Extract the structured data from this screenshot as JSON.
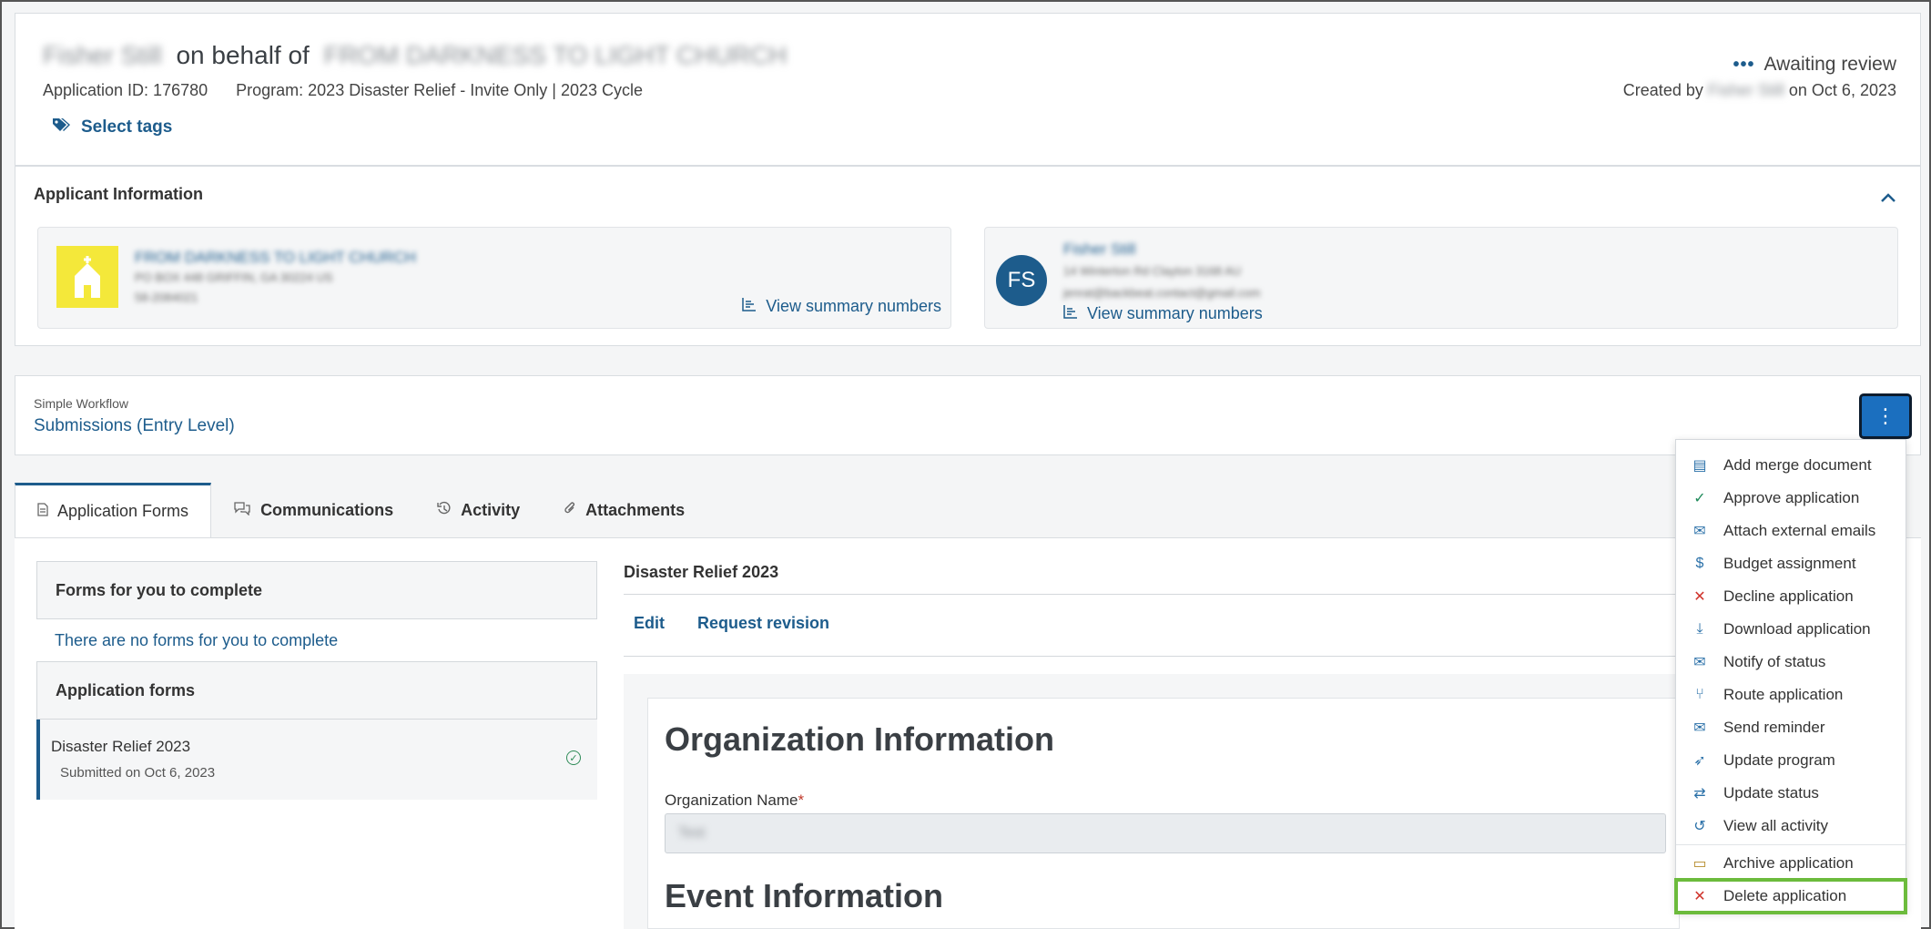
{
  "header": {
    "applicant_name_blurred": "Fisher Still",
    "on_behalf_of": "on behalf of",
    "organization_blurred": "FROM DARKNESS TO LIGHT CHURCH",
    "application_id": "Application ID: 176780",
    "program": "Program: 2023 Disaster Relief - Invite Only | 2023 Cycle",
    "select_tags_label": "Select tags",
    "status_label": "Awaiting review",
    "created_prefix": "Created by",
    "created_by_blurred": "Fisher Still",
    "created_suffix": "on Oct 6, 2023"
  },
  "applicant_info": {
    "title": "Applicant Information",
    "organization": {
      "name": "FROM DARKNESS TO LIGHT CHURCH",
      "address": "PO BOX 448 GRIFFIN, GA 30224 US",
      "ein": "58-2084021",
      "summary_link": "View summary numbers"
    },
    "person": {
      "initials": "FS",
      "name": "Fisher Still",
      "address": "14 Winterton Rd Clayton 3168 AU",
      "email": "jenrat@backbeat.contact@gmail.com",
      "summary_link": "View summary numbers"
    }
  },
  "workflow": {
    "label": "Simple Workflow",
    "value": "Submissions (Entry Level)",
    "kebab": "⋮"
  },
  "tabs": [
    {
      "label": "Application Forms",
      "icon": "document-icon"
    },
    {
      "label": "Communications",
      "icon": "chat-icon"
    },
    {
      "label": "Activity",
      "icon": "history-icon"
    },
    {
      "label": "Attachments",
      "icon": "paperclip-icon"
    }
  ],
  "forms_panel": {
    "to_complete_title": "Forms for you to complete",
    "empty_message": "There are no forms for you to complete",
    "application_forms_title": "Application forms",
    "form_name": "Disaster Relief 2023",
    "form_sub": "Submitted on Oct 6, 2023"
  },
  "form_preview": {
    "title": "Disaster Relief 2023",
    "edit_label": "Edit",
    "request_revision_label": "Request revision",
    "heading_org": "Organization Information",
    "org_name_label": "Organization Name",
    "required_mark": "*",
    "org_name_value": "Test",
    "heading_event": "Event Information"
  },
  "menu": {
    "items": [
      {
        "label": "Add merge document",
        "icon": "merge-document-icon",
        "glyph": "▤"
      },
      {
        "label": "Approve application",
        "icon": "check-icon",
        "glyph": "✓"
      },
      {
        "label": "Attach external emails",
        "icon": "email-attach-icon",
        "glyph": "✉"
      },
      {
        "label": "Budget assignment",
        "icon": "dollar-icon",
        "glyph": "$"
      },
      {
        "label": "Decline application",
        "icon": "x-icon",
        "glyph": "✕"
      },
      {
        "label": "Download application",
        "icon": "download-icon",
        "glyph": "⤓"
      },
      {
        "label": "Notify of status",
        "icon": "envelope-icon",
        "glyph": "✉"
      },
      {
        "label": "Route application",
        "icon": "route-icon",
        "glyph": "⑂"
      },
      {
        "label": "Send reminder",
        "icon": "envelope-icon",
        "glyph": "✉"
      },
      {
        "label": "Update program",
        "icon": "rocket-icon",
        "glyph": "➶"
      },
      {
        "label": "Update status",
        "icon": "swap-icon",
        "glyph": "⇄"
      },
      {
        "label": "View all activity",
        "icon": "history-icon",
        "glyph": "↺"
      },
      {
        "label": "Archive application",
        "icon": "archive-icon",
        "glyph": "▭"
      },
      {
        "label": "Delete application",
        "icon": "x-icon",
        "glyph": "✕"
      }
    ]
  },
  "colors": {
    "primary": "#1d5c8c",
    "button_blue": "#1b6fbf",
    "highlight_green": "#6cbb3c",
    "danger_red": "#d0342c",
    "org_logo_yellow": "#f4e83a"
  }
}
